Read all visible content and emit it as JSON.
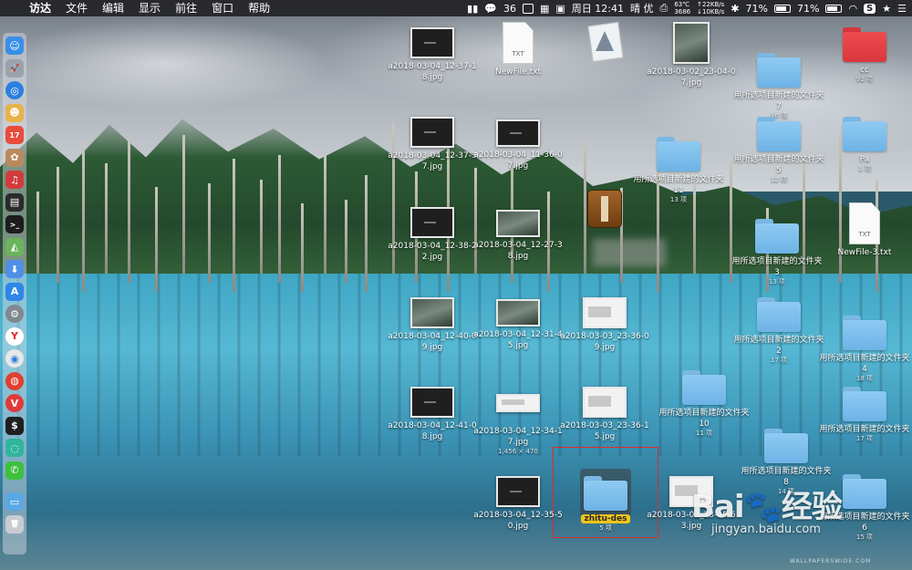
{
  "menubar": {
    "apple": "",
    "app_name": "访达",
    "menus": [
      "文件",
      "编辑",
      "显示",
      "前往",
      "窗口",
      "帮助"
    ],
    "wechat_badge": "36",
    "clock": "周日 12:41",
    "weather": "晴 优",
    "cpu_temp": "63℃",
    "cpu_fan": "3686",
    "net_up": "↑22KB/s",
    "net_down": "↓10KB/s",
    "battery_1": "71%",
    "battery_2": "71%",
    "star": "★"
  },
  "dock": {
    "icons": [
      "finder-icon",
      "launchpad-icon",
      "safari-icon",
      "contacts-icon",
      "calendar-icon",
      "photo-icon",
      "music-icon",
      "activity-icon",
      "terminal-icon",
      "maps-icon",
      "download-icon",
      "appstore-icon",
      "settings-icon",
      "yandex-icon",
      "chrome-icon",
      "weibo-icon",
      "vivaldi-icon",
      "console-icon",
      "cleaner-icon",
      "wechat-icon",
      "downloads-folder-icon",
      "trash-icon"
    ]
  },
  "desktop": {
    "col1": [
      {
        "label": "a2018-03-04_12-37-18.jpg"
      },
      {
        "label": "a2018-03-04_12-37-37.jpg"
      },
      {
        "label": "a2018-03-04_12-38-22.jpg"
      },
      {
        "label": "a2018-03-04_12-40-09.jpg"
      },
      {
        "label": "a2018-03-04_12-41-08.jpg"
      }
    ],
    "col2": [
      {
        "label": "NewFile.txt",
        "tag": "TXT"
      },
      {
        "label": "a2018-03-04_11-36-07.jpg"
      },
      {
        "label": "a2018-03-04_12-27-38.jpg"
      },
      {
        "label": "a2018-03-04_12-31-45.jpg"
      },
      {
        "label": "a2018-03-04_12-34-17.jpg",
        "sub": "1,456 × 470"
      },
      {
        "label": "a2018-03-04_12-35-50.jpg"
      }
    ],
    "col3": [
      {
        "label": "a2018-03-03_23-36-09.jpg"
      },
      {
        "label": "a2018-03-03_23-36-15.jpg"
      },
      {
        "label": "zhitu-des",
        "sub": "5 项"
      }
    ],
    "col4": [
      {
        "label": "a2018-03-02_23-04-07.jpg"
      },
      {
        "label": "用所选项目新建的文件夹 11",
        "sub": "13 项"
      },
      {
        "label": "用所选项目新建的文件夹 10",
        "sub": "11 项"
      },
      {
        "label": "a2018-03-03_23-35-53.jpg"
      }
    ],
    "col5": [
      {
        "label": "用所选项目新建的文件夹 7",
        "sub": "16 项"
      },
      {
        "label": "用所选项目新建的文件夹 5",
        "sub": "12 项"
      },
      {
        "label": "用所选项目新建的文件夹 3",
        "sub": "13 项"
      },
      {
        "label": "用所选项目新建的文件夹 2",
        "sub": "17 项"
      },
      {
        "label": "用所选项目新建的文件夹 8",
        "sub": "14 项"
      }
    ],
    "col6": [
      {
        "label": "cc",
        "sub": "92 项"
      },
      {
        "label": "Pa",
        "sub": "1 项"
      },
      {
        "label": "NewFile-3.txt",
        "tag": "TXT"
      },
      {
        "label": "用所选项目新建的文件夹 4",
        "sub": "18 项"
      },
      {
        "label": "用所选项目新建的文件夹",
        "sub": "17 项"
      },
      {
        "label": "用所选项目新建的文件夹 6",
        "sub": "15 项"
      }
    ]
  },
  "watermark": {
    "logo": "Bai",
    "logo_suffix": "经验",
    "url": "jingyan.baidu.com",
    "wallpaper": "WALLPAPERSWIDE.COM"
  },
  "colors": {
    "menubar_bg": "#232326",
    "folder_blue": "#6db3e6",
    "folder_red": "#d8383c",
    "selection_label": "#f0c419",
    "selection_box": "#e02a2a"
  }
}
